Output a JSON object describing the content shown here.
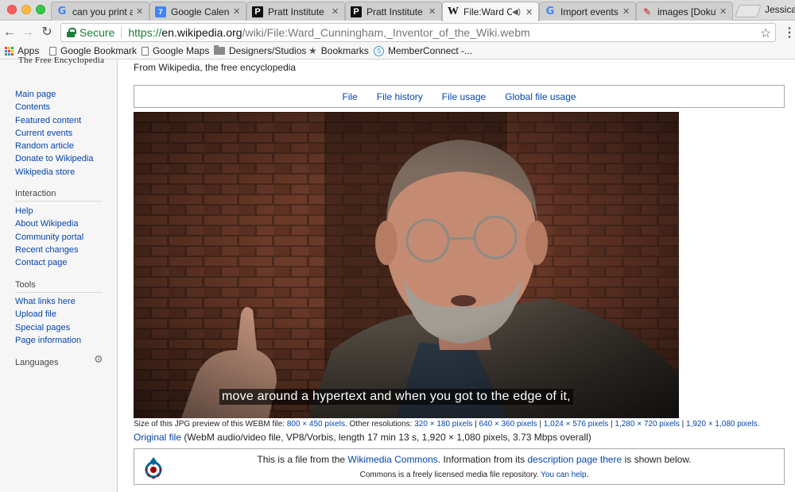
{
  "browser": {
    "tabs": [
      {
        "title": "can you print a",
        "icon": "google-icon"
      },
      {
        "title": "Google Calenda",
        "icon": "calendar-icon",
        "badge": "7"
      },
      {
        "title": "Pratt Institute",
        "icon": "pratt-icon"
      },
      {
        "title": "Pratt Institute",
        "icon": "pratt-icon"
      },
      {
        "title": "File:Ward Cu",
        "icon": "wikipedia-icon",
        "active": true
      },
      {
        "title": "Import events t",
        "icon": "google-icon"
      },
      {
        "title": "images [DokuW",
        "icon": "dokuwiki-icon"
      }
    ],
    "user": "Jessica",
    "secure_label": "Secure",
    "url_scheme": "https://",
    "url_host": "en.wikipedia.org",
    "url_path": "/wiki/File:Ward_Cunningham,_Inventor_of_the_Wiki.webm",
    "bookmarks": [
      {
        "label": "Apps",
        "icon": "apps-icon"
      },
      {
        "label": "Google Bookmark",
        "icon": "page-icon"
      },
      {
        "label": "Google Maps",
        "icon": "page-icon"
      },
      {
        "label": "Designers/Studios",
        "icon": "folder-icon"
      },
      {
        "label": "Bookmarks",
        "icon": "star-icon"
      },
      {
        "label": "MemberConnect -...",
        "icon": "memberconnect-icon"
      }
    ]
  },
  "wiki": {
    "logo_text": "The Free Encyclopedia",
    "tagline": "From Wikipedia, the free encyclopedia",
    "nav_main": [
      "Main page",
      "Contents",
      "Featured content",
      "Current events",
      "Random article",
      "Donate to Wikipedia",
      "Wikipedia store"
    ],
    "interaction_heading": "Interaction",
    "nav_interaction": [
      "Help",
      "About Wikipedia",
      "Community portal",
      "Recent changes",
      "Contact page"
    ],
    "tools_heading": "Tools",
    "nav_tools": [
      "What links here",
      "Upload file",
      "Special pages",
      "Page information"
    ],
    "languages_heading": "Languages",
    "file_tabs": [
      "File",
      "File history",
      "File usage",
      "Global file usage"
    ],
    "video_caption": "move around a hypertext and when you got to the edge of it,",
    "size_prefix": "Size of this JPG preview of this WEBM file: ",
    "size_preview": "800 × 450 pixels",
    "size_other_prefix": ". Other resolutions: ",
    "resolutions": [
      "320 × 180 pixels",
      "640 × 360 pixels",
      "1,024 × 576 pixels",
      "1,280 × 720 pixels",
      "1,920 × 1,080 pixels"
    ],
    "resolution_separator": " | ",
    "original_file_link": "Original file",
    "original_file_details": " (WebM audio/video file, VP8/Vorbis, length 17 min 13 s, 1,920 × 1,080 pixels, 3.73 Mbps overall)",
    "commons_l1_a": "This is a file from the ",
    "commons_link": "Wikimedia Commons",
    "commons_l1_b": ". Information from its ",
    "commons_desc_link": "description page there",
    "commons_l1_c": " is shown below.",
    "commons_l2_a": "Commons is a freely licensed media file repository. ",
    "commons_help_link": "You can help",
    "commons_l2_b": "."
  }
}
